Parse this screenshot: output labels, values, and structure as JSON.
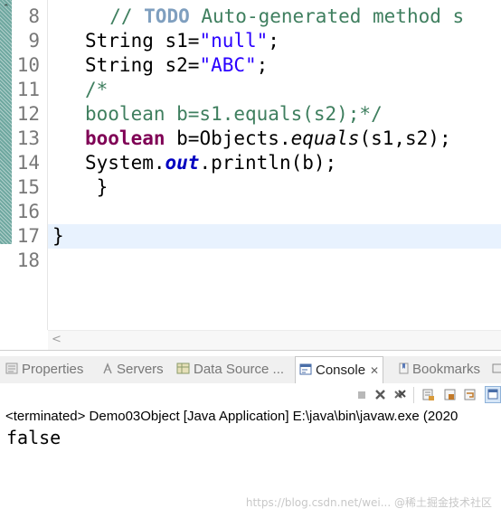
{
  "editor": {
    "line_numbers": [
      "8",
      "9",
      "10",
      "11",
      "12",
      "13",
      "14",
      "15",
      "16",
      "17",
      "18"
    ],
    "lines": {
      "l8_indent": "     ",
      "l8_comment": "// ",
      "l8_todo": "TODO",
      "l8_rest": " Auto-generated method s",
      "l9_a": "String s1=",
      "l9_str": "\"null\"",
      "l9_b": ";",
      "l10_a": "String s2=",
      "l10_str": "\"ABC\"",
      "l10_b": ";",
      "l11": "/*",
      "l12": "boolean b=s1.equals(s2);*/",
      "l13_kw": "boolean",
      "l13_a": " b=Objects.",
      "l13_m": "equals",
      "l13_b": "(s1,s2);",
      "l14_a": "System.",
      "l14_f": "out",
      "l14_b": ".println(b);",
      "l15": " }",
      "l17": "}"
    }
  },
  "view": {
    "tabs": [
      {
        "label": "Properties",
        "icon": "properties-icon"
      },
      {
        "label": "Servers",
        "icon": "servers-icon"
      },
      {
        "label": "Data Source ...",
        "icon": "data-source-icon"
      },
      {
        "label": "Console",
        "icon": "console-icon",
        "active": true
      },
      {
        "label": "Bookmarks",
        "icon": "bookmarks-icon"
      }
    ],
    "console": {
      "status": "<terminated> Demo03Object [Java Application] E:\\java\\bin\\javaw.exe (2020",
      "output": "false"
    },
    "watermark": "https://blog.csdn.net/wei... @稀土掘金技术社区"
  },
  "colors": {
    "keyword": "#7f0055",
    "string": "#2a00ff",
    "comment": "#3f7f5f",
    "todo": "#7f9fbf",
    "static_field": "#0000c0",
    "current_line": "#e8f2fe"
  }
}
